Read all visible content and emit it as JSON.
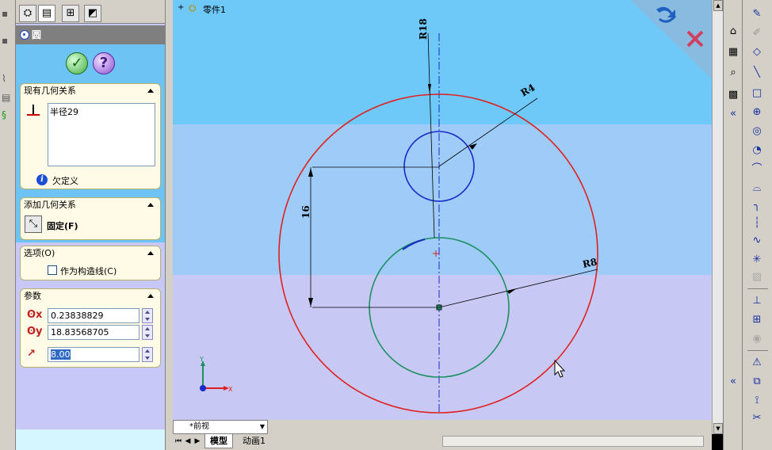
{
  "tree": {
    "part_name": "零件1"
  },
  "property_manager": {
    "title": "圆",
    "groups": {
      "existing_relations": {
        "title": "现有几何关系",
        "items": [
          "半径29"
        ],
        "status": "欠定义"
      },
      "add_relations": {
        "title": "添加几何关系",
        "fix_label": "固定(F)"
      },
      "options": {
        "title": "选项(O)",
        "construction_label": "作为构造线(C)",
        "construction_checked": false
      },
      "parameters": {
        "title": "参数",
        "x_value": "0.23838829",
        "y_value": "18.83568705",
        "radius_value": "8.00"
      }
    }
  },
  "sketch": {
    "dimensions": {
      "r18": "R18",
      "r4": "R4",
      "r8": "R8",
      "d16": "16"
    },
    "triad": {
      "x": "X",
      "y": "Y"
    },
    "colors": {
      "outer_circle": "#e02020",
      "small_circle": "#1a2ac8",
      "active_circle": "#1a9060",
      "centerline": "#1a2ac8"
    }
  },
  "bottom": {
    "view_name": "*前视",
    "tabs": [
      "模型",
      "动画1"
    ]
  }
}
